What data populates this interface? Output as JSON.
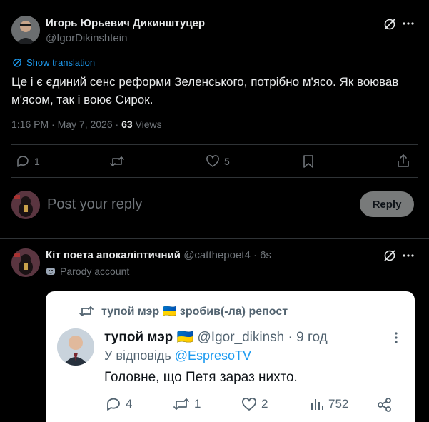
{
  "main_tweet": {
    "author_name": "Игорь Юрьевич Дикинштуцер",
    "handle": "@IgorDikinshtein",
    "show_translation": "Show translation",
    "text_line1": "Це і є єдиний сенс реформи Зеленського, потрібно м'ясо. Як воював",
    "text_line2": "м'ясом, так і воює Сирок.",
    "timestamp": "1:16 PM · May 7, 2026 · ",
    "views_count": "63",
    "views_label": " Views",
    "actions": {
      "replies": "1",
      "retweets": "",
      "likes": "5"
    }
  },
  "reply_box": {
    "placeholder": "Post your reply",
    "button_label": "Reply"
  },
  "reply_tweet": {
    "author_name": "Кіт поета апокаліптичний",
    "handle_time": "@catthepoet4 · 6s",
    "parody_label": "Parody account",
    "quote": {
      "repost_label": "тупой мэр 🇺🇦 зробив(-ла) репост",
      "author_name": "тупой мэр 🇺🇦",
      "handle_time": "@Igor_dikinsh · 9 год",
      "reply_to_prefix": "У відповідь ",
      "reply_to_handle": "@EspresoTV",
      "text": "Головне, що Петя зараз нихто.",
      "actions": {
        "replies": "4",
        "reposts": "1",
        "likes": "2",
        "views": "752"
      }
    }
  },
  "colors": {
    "accent": "#1d9bf0",
    "muted": "#71767b",
    "divider": "#2f3336"
  }
}
